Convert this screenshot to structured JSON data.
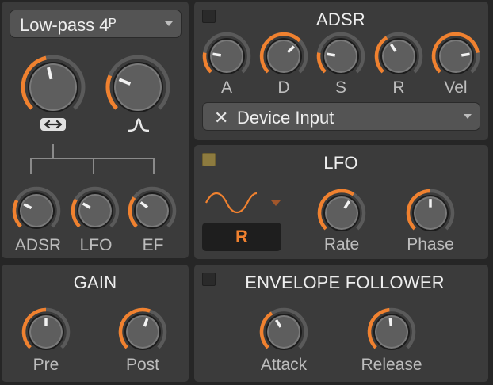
{
  "filter": {
    "mode_dropdown": "Low-pass 4ᴾ",
    "mod_labels": [
      "ADSR",
      "LFO",
      "EF"
    ]
  },
  "adsr": {
    "title": "ADSR",
    "knobs": [
      "A",
      "D",
      "S",
      "R",
      "Vel"
    ],
    "source_dropdown": "Device Input",
    "clear_glyph": "✕"
  },
  "lfo": {
    "title": "LFO",
    "retrigger_button": "R",
    "knobs": [
      "Rate",
      "Phase"
    ],
    "waveform": "sine"
  },
  "gain": {
    "title": "GAIN",
    "knobs": [
      "Pre",
      "Post"
    ]
  },
  "envelope_follower": {
    "title": "ENVELOPE FOLLOWER",
    "knobs": [
      "Attack",
      "Release"
    ]
  },
  "colors": {
    "accent": "#f0812f",
    "panel": "#3b3b3b",
    "background": "#262626",
    "lfo_toggle_on": "#8d7b3f"
  },
  "knob_values": {
    "filter_cutoff": 0.45,
    "filter_resonance": 0.25,
    "mod_adsr": 0.27,
    "mod_lfo": 0.28,
    "mod_ef": 0.3,
    "adsr_a": 0.2,
    "adsr_d": 0.67,
    "adsr_s": 0.2,
    "adsr_r": 0.38,
    "adsr_vel": 0.8,
    "lfo_rate": 0.62,
    "lfo_phase": 0.5,
    "gain_pre": 0.5,
    "gain_post": 0.57,
    "ef_attack": 0.38,
    "ef_release": 0.48
  }
}
